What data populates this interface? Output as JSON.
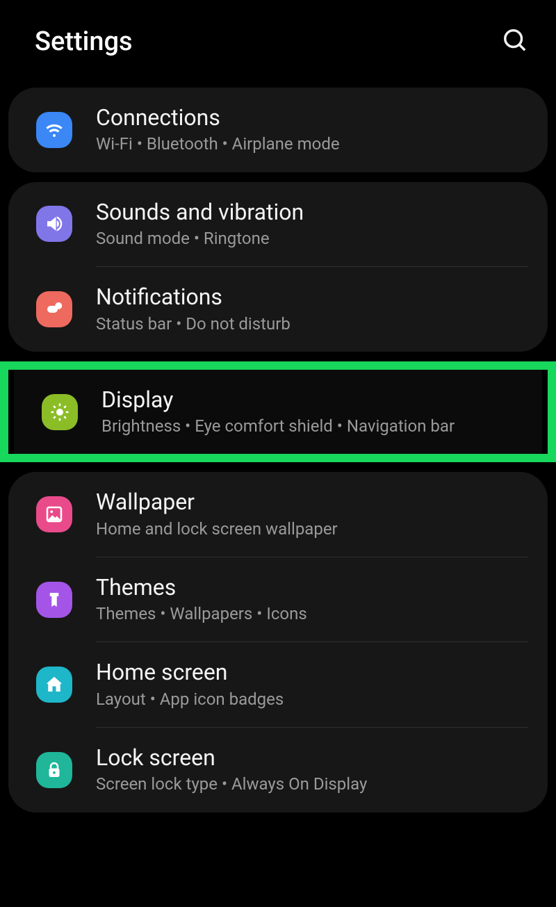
{
  "header": {
    "title": "Settings"
  },
  "groups": [
    {
      "items": [
        {
          "title": "Connections",
          "sub": "Wi-Fi  •  Bluetooth  •  Airplane mode"
        }
      ]
    },
    {
      "items": [
        {
          "title": "Sounds and vibration",
          "sub": "Sound mode  •  Ringtone"
        },
        {
          "title": "Notifications",
          "sub": "Status bar  •  Do not disturb"
        }
      ]
    },
    {
      "highlighted": true,
      "items": [
        {
          "title": "Display",
          "sub": "Brightness  •  Eye comfort shield  •  Navigation bar"
        }
      ]
    },
    {
      "items": [
        {
          "title": "Wallpaper",
          "sub": "Home and lock screen wallpaper"
        },
        {
          "title": "Themes",
          "sub": "Themes  •  Wallpapers  •  Icons"
        },
        {
          "title": "Home screen",
          "sub": "Layout  •  App icon badges"
        },
        {
          "title": "Lock screen",
          "sub": "Screen lock type  •  Always On Display"
        }
      ]
    }
  ]
}
